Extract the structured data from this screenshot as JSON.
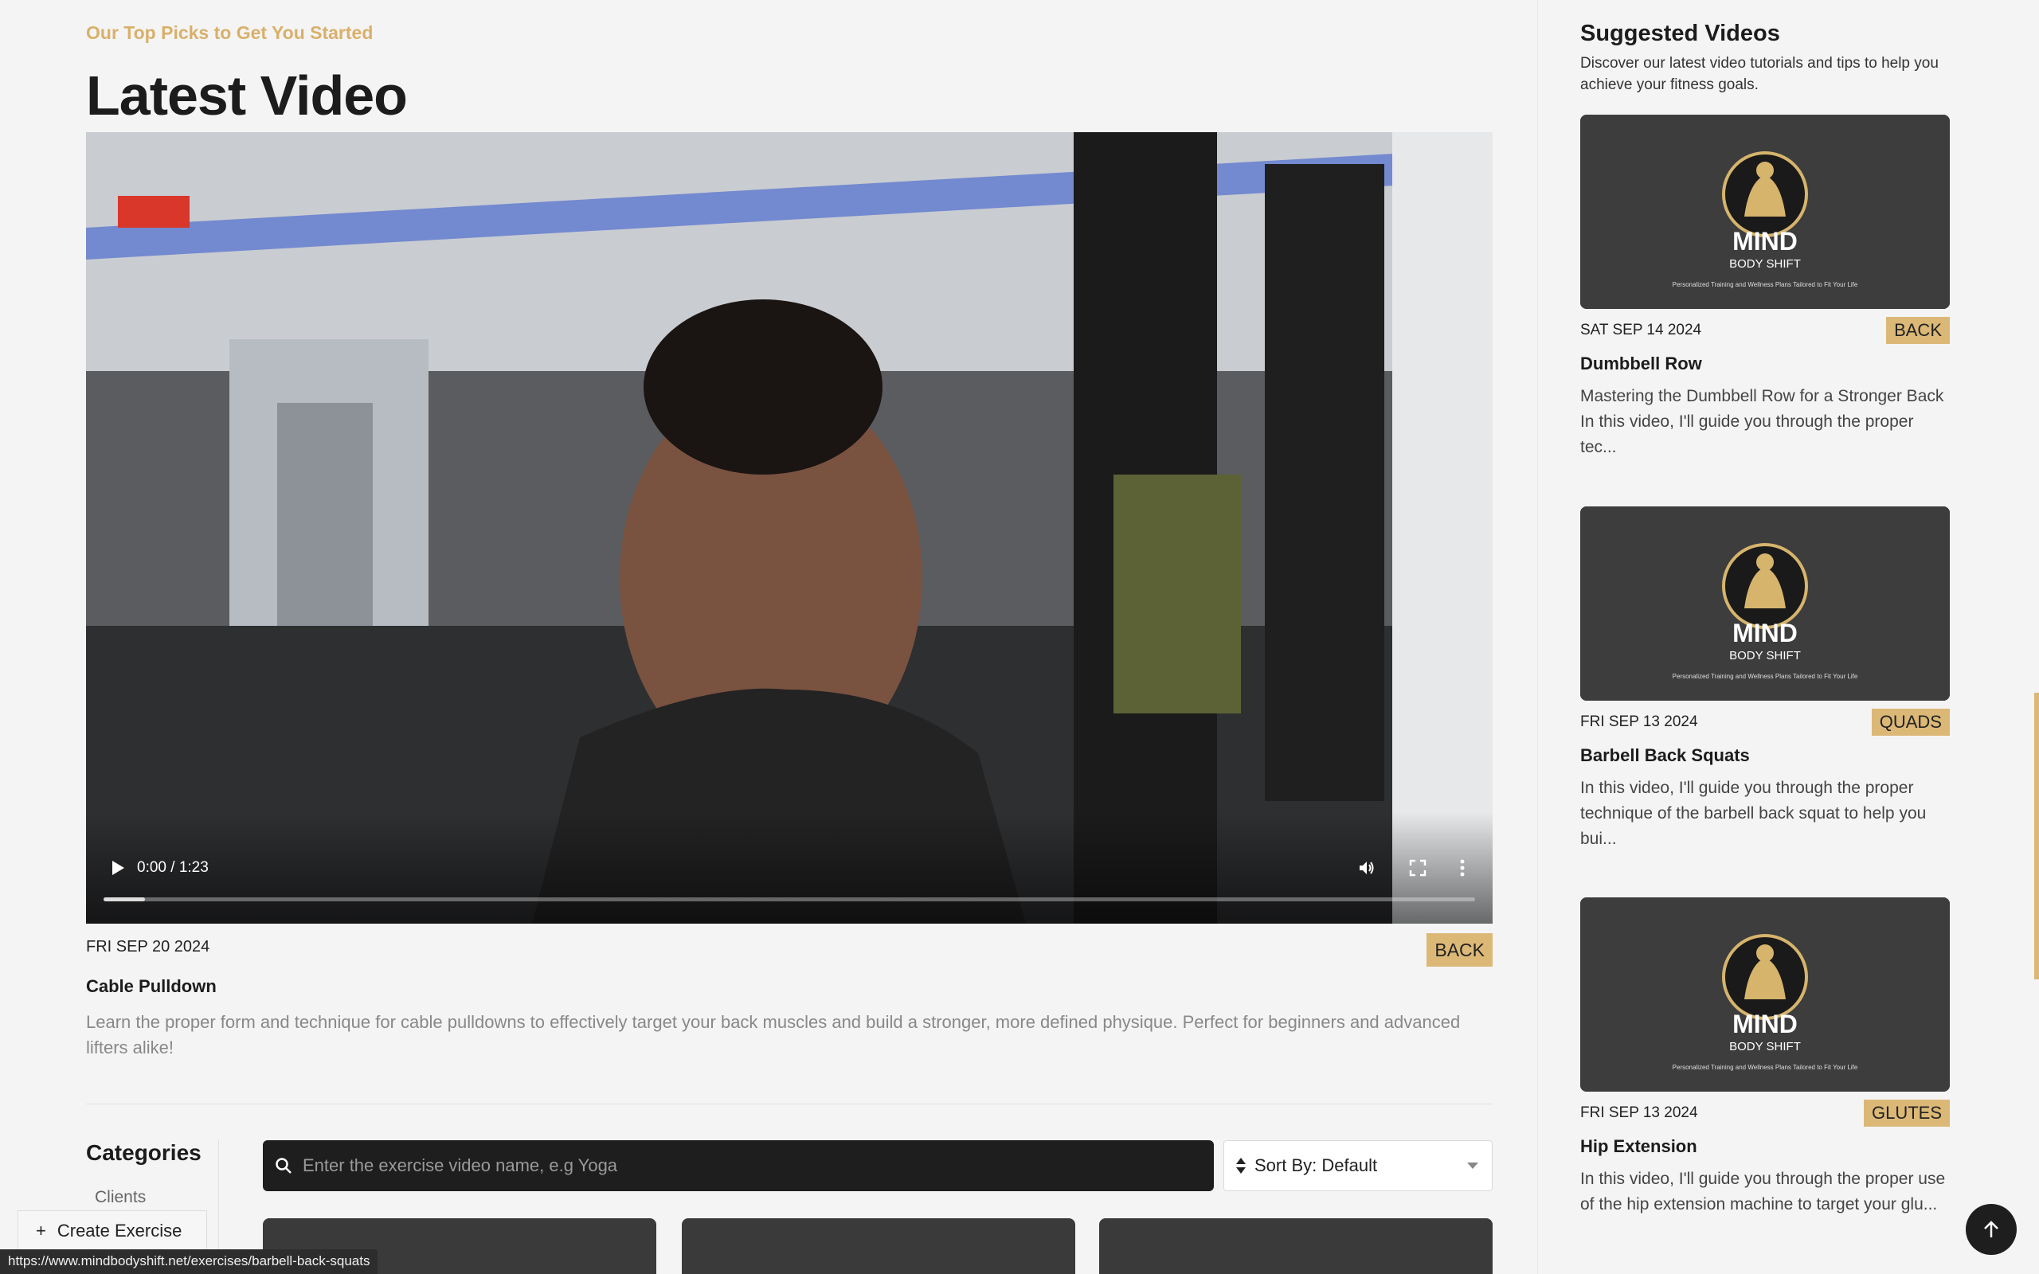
{
  "header": {
    "eyebrow": "Our Top Picks to Get You Started",
    "title": "Latest Video"
  },
  "latest_video": {
    "player": {
      "time": "0:00 / 1:23",
      "progress": 0.03
    },
    "date": "FRI SEP 20 2024",
    "tag": "BACK",
    "name": "Cable Pulldown",
    "description": "Learn the proper form and technique for cable pulldowns to effectively target your back muscles and build a stronger, more defined physique. Perfect for beginners and advanced lifters alike!"
  },
  "categories": {
    "title": "Categories",
    "items": [
      "Clients"
    ]
  },
  "search": {
    "placeholder": "Enter the exercise video name, e.g Yoga"
  },
  "sort": {
    "label": "Sort By: Default"
  },
  "sidebar": {
    "title": "Suggested Videos",
    "description": "Discover our latest video tutorials and tips to help you achieve your fitness goals.",
    "thumbnail_brand": {
      "word": "MIND",
      "sub": "BODY SHIFT",
      "tagline": "Personalized Training and Wellness Plans Tailored to Fit Your Life"
    },
    "videos": [
      {
        "date": "SAT SEP 14 2024",
        "tag": "BACK",
        "name": "Dumbbell Row",
        "description": "Mastering the Dumbbell Row for a Stronger Back In this video, I'll guide you through the proper tec..."
      },
      {
        "date": "FRI SEP 13 2024",
        "tag": "QUADS",
        "name": "Barbell Back Squats",
        "description": "In this video, I'll guide you through the proper technique of the barbell back squat to help you bui..."
      },
      {
        "date": "FRI SEP 13 2024",
        "tag": "GLUTES",
        "name": "Hip Extension",
        "description": "In this video, I'll guide you through the proper use of the hip extension machine to target your glu..."
      }
    ]
  },
  "create_exercise": {
    "label": "Create Exercise"
  },
  "status_bar": {
    "url": "https://www.mindbodyshift.net/exercises/barbell-back-squats"
  },
  "colors": {
    "accent": "#dcb877",
    "eyebrow": "#d9b06a",
    "dark": "#1e1e1e"
  },
  "icons": [
    "play-icon",
    "volume-icon",
    "fullscreen-icon",
    "more-vertical-icon",
    "search-icon",
    "sort-icon",
    "chevron-down-icon",
    "arrow-up-icon",
    "plus-icon"
  ]
}
